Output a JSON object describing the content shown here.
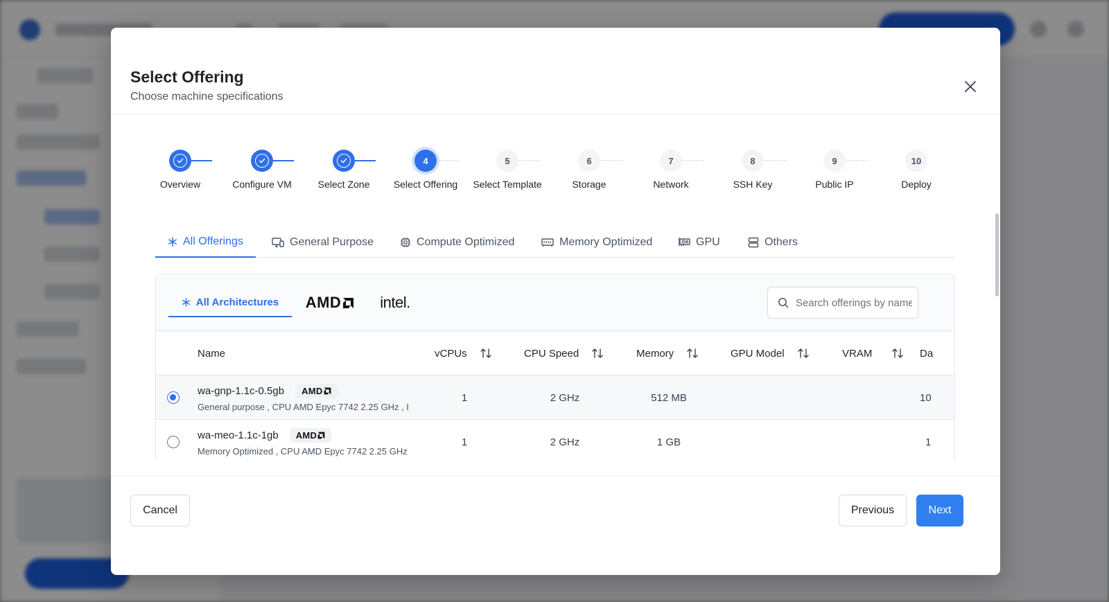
{
  "modal": {
    "title": "Select Offering",
    "subtitle": "Choose machine specifications"
  },
  "stepper": {
    "steps": [
      {
        "number": "1",
        "label": "Overview",
        "status": "done"
      },
      {
        "number": "2",
        "label": "Configure VM",
        "status": "done"
      },
      {
        "number": "3",
        "label": "Select Zone",
        "status": "done"
      },
      {
        "number": "4",
        "label": "Select Offering",
        "status": "current"
      },
      {
        "number": "5",
        "label": "Select Template",
        "status": "todo"
      },
      {
        "number": "6",
        "label": "Storage",
        "status": "todo"
      },
      {
        "number": "7",
        "label": "Network",
        "status": "todo"
      },
      {
        "number": "8",
        "label": "SSH Key",
        "status": "todo"
      },
      {
        "number": "9",
        "label": "Public IP",
        "status": "todo"
      },
      {
        "number": "10",
        "label": "Deploy",
        "status": "todo"
      }
    ]
  },
  "category_tabs": [
    {
      "label": "All Offerings",
      "icon": "asterisk-icon",
      "active": true
    },
    {
      "label": "General Purpose",
      "icon": "devices-icon",
      "active": false
    },
    {
      "label": "Compute Optimized",
      "icon": "cpu-chip-icon",
      "active": false
    },
    {
      "label": "Memory Optimized",
      "icon": "memory-module-icon",
      "active": false
    },
    {
      "label": "GPU",
      "icon": "gpu-card-icon",
      "active": false
    },
    {
      "label": "Others",
      "icon": "server-stack-icon",
      "active": false
    }
  ],
  "architecture": {
    "all_label": "All Architectures",
    "amd_label": "AMD",
    "intel_label": "intel."
  },
  "search": {
    "placeholder": "Search offerings by name",
    "value": ""
  },
  "table": {
    "columns": {
      "name": "Name",
      "vcpus": "vCPUs",
      "cpu_speed": "CPU Speed",
      "memory": "Memory",
      "gpu_model": "GPU Model",
      "vram": "VRAM",
      "partial": "Da"
    },
    "rows": [
      {
        "name": "wa-gnp-1.1c-0.5gb",
        "badge": "AMD",
        "description": "General purpose , CPU AMD Epyc 7742 2.25 GHz , I",
        "vcpus": "1",
        "cpu_speed": "2 GHz",
        "memory": "512 MB",
        "gpu_model": "",
        "vram": "",
        "partial": "10",
        "selected": true
      },
      {
        "name": "wa-meo-1.1c-1gb",
        "badge": "AMD",
        "description": "Memory Optimized , CPU AMD Epyc 7742 2.25 GHz",
        "vcpus": "1",
        "cpu_speed": "2 GHz",
        "memory": "1 GB",
        "gpu_model": "",
        "vram": "",
        "partial": "1",
        "selected": false
      }
    ]
  },
  "footer": {
    "cancel_label": "Cancel",
    "previous_label": "Previous",
    "next_label": "Next"
  },
  "colors": {
    "accent": "#2f6fe8",
    "primary_button": "#2f7ff0",
    "step_ring": "#cfe0ff"
  }
}
